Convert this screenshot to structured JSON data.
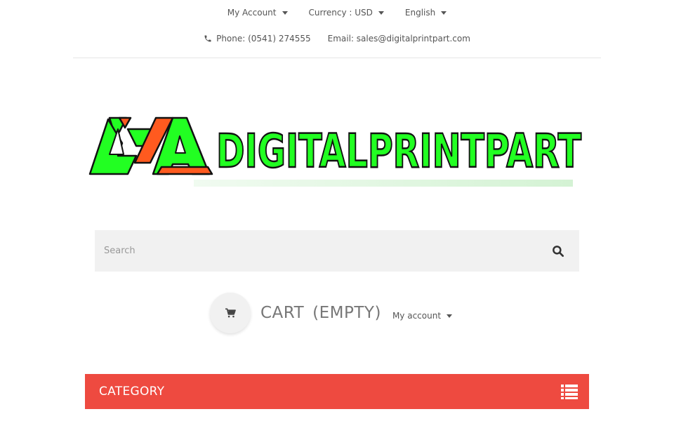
{
  "header": {
    "my_account": "My Account",
    "currency": "Currency : USD",
    "language": "English",
    "phone": "Phone: (0541) 274555",
    "email": "Email: sales@digitalprintpart.com"
  },
  "logo": {
    "text": "DIGITALPRINTPART",
    "colors": {
      "fill": "#22ff22",
      "accent": "#ff5a1f",
      "outline": "#111111"
    }
  },
  "search": {
    "placeholder": "Search",
    "icon": "search-icon"
  },
  "cart": {
    "label": "CART",
    "status": "(EMPTY)",
    "icon": "cart-icon",
    "my_account": "My account"
  },
  "category": {
    "title": "CATEGORY",
    "icon": "list-menu-icon",
    "color": "#ee4a40"
  }
}
